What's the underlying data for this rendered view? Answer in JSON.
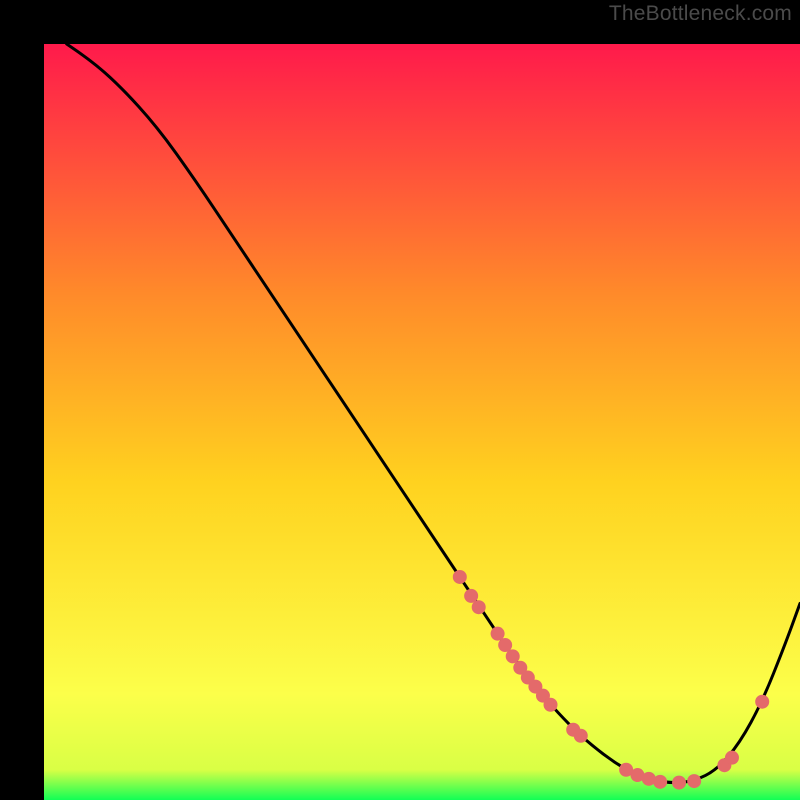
{
  "watermark": "TheBottleneck.com",
  "colors": {
    "gradient_top": "#ff1a4b",
    "gradient_mid1": "#ff6a2f",
    "gradient_mid2": "#ffd21f",
    "gradient_mid3": "#fff93a",
    "gradient_bottom": "#11ff55",
    "line": "#000000",
    "dot": "#e46a6a",
    "bg": "#000000"
  },
  "chart_data": {
    "type": "line",
    "title": "",
    "xlabel": "",
    "ylabel": "",
    "xlim": [
      0,
      100
    ],
    "ylim": [
      0,
      100
    ],
    "series": [
      {
        "name": "curve",
        "x": [
          3,
          6,
          10,
          15,
          20,
          25,
          30,
          35,
          40,
          45,
          50,
          55,
          60,
          62,
          65,
          68,
          71,
          74,
          77,
          80,
          83,
          86,
          89,
          92,
          95,
          98,
          100
        ],
        "y": [
          100,
          98,
          94.5,
          89,
          82,
          74.5,
          67,
          59.5,
          52,
          44.5,
          37,
          29.5,
          22,
          19,
          15,
          11.5,
          8.5,
          6,
          4,
          2.8,
          2.2,
          2.5,
          4,
          7.5,
          13,
          20.5,
          26
        ]
      }
    ],
    "dots": [
      {
        "x": 55,
        "y": 29.5
      },
      {
        "x": 56.5,
        "y": 27
      },
      {
        "x": 57.5,
        "y": 25.5
      },
      {
        "x": 60,
        "y": 22
      },
      {
        "x": 61,
        "y": 20.5
      },
      {
        "x": 62,
        "y": 19
      },
      {
        "x": 63,
        "y": 17.5
      },
      {
        "x": 64,
        "y": 16.2
      },
      {
        "x": 65,
        "y": 15
      },
      {
        "x": 66,
        "y": 13.8
      },
      {
        "x": 67,
        "y": 12.6
      },
      {
        "x": 70,
        "y": 9.3
      },
      {
        "x": 71,
        "y": 8.5
      },
      {
        "x": 77,
        "y": 4
      },
      {
        "x": 78.5,
        "y": 3.3
      },
      {
        "x": 80,
        "y": 2.8
      },
      {
        "x": 81.5,
        "y": 2.4
      },
      {
        "x": 84,
        "y": 2.3
      },
      {
        "x": 86,
        "y": 2.5
      },
      {
        "x": 90,
        "y": 4.6
      },
      {
        "x": 91,
        "y": 5.6
      },
      {
        "x": 95,
        "y": 13
      }
    ]
  }
}
